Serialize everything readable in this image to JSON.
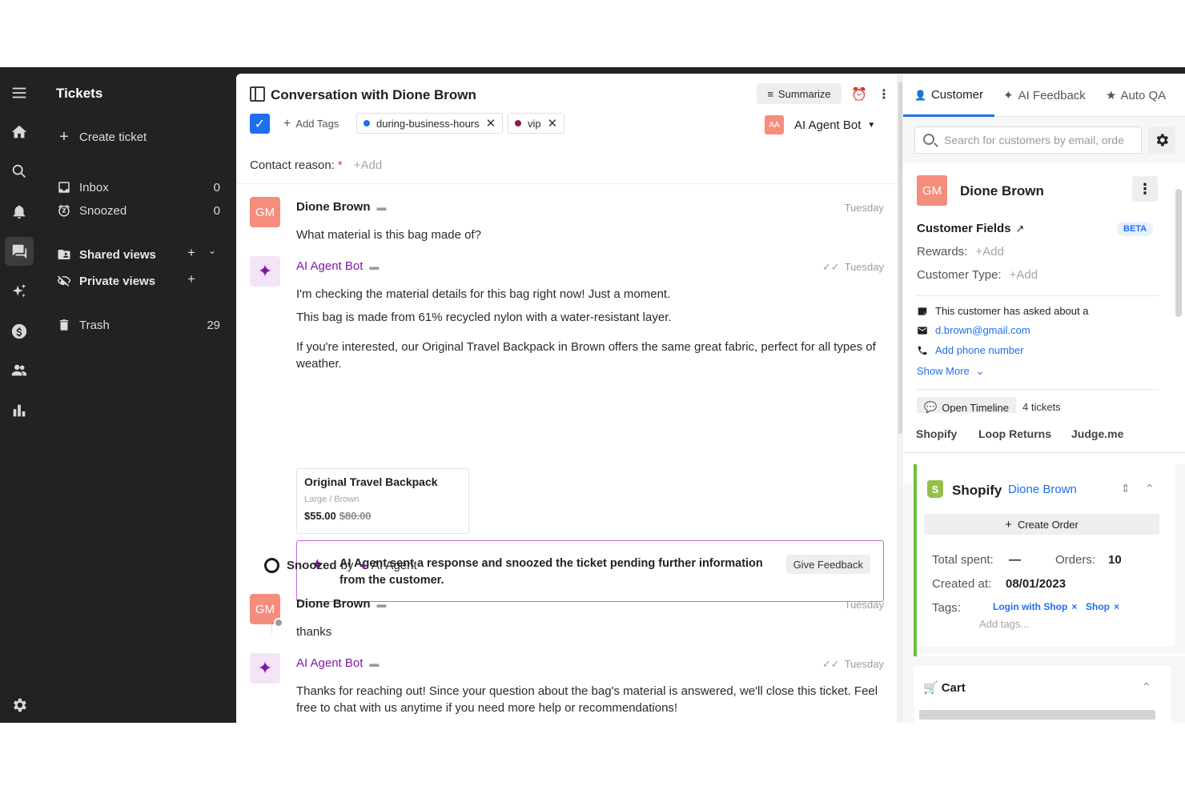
{
  "sidebar": {
    "title": "Tickets",
    "create_ticket": "Create ticket",
    "inbox_label": "Inbox",
    "inbox_count": "0",
    "snoozed_label": "Snoozed",
    "snoozed_count": "0",
    "shared_views": "Shared views",
    "private_views": "Private views",
    "trash_label": "Trash",
    "trash_count": "29"
  },
  "conversation": {
    "title": "Conversation with Dione Brown",
    "summarize": "Summarize",
    "add_tags": "Add Tags",
    "tags": [
      {
        "label": "during-business-hours",
        "color": "#1e6ff0"
      },
      {
        "label": "vip",
        "color": "#8a1d4a"
      }
    ],
    "assignee_initials": "AA",
    "assignee": "AI Agent Bot",
    "contact_reason_label": "Contact reason:",
    "contact_reason_required": "*",
    "contact_reason_add": "+Add"
  },
  "messages": {
    "m1": {
      "initials": "GM",
      "sender": "Dione Brown",
      "time": "Tuesday",
      "text": "What material is this bag made of?"
    },
    "m2": {
      "sender": "AI Agent Bot",
      "time": "Tuesday",
      "line1": "I'm checking the material details for this bag right now! Just a moment.",
      "line2": "This bag is made from 61% recycled nylon with a water-resistant layer.",
      "line3": "If you're interested, our Original Travel Backpack in Brown offers the same great fabric, perfect for all types of weather.",
      "product": {
        "name": "Original Travel Backpack",
        "variant": "Large / Brown",
        "price": "$55.00",
        "compare_price": "$80.00"
      },
      "note": "AI Agent sent a response and snoozed the ticket pending further information from the customer.",
      "feedback_button": "Give Feedback"
    },
    "snooze": {
      "prefix": "Snoozed",
      "by": "by",
      "agent": "AI Agent"
    },
    "m3": {
      "initials": "GM",
      "sender": "Dione Brown",
      "time": "Tuesday",
      "text": "thanks"
    },
    "m4": {
      "sender": "AI Agent Bot",
      "time": "Tuesday",
      "text": "Thanks for reaching out! Since your question about the bag's material is answered, we'll close this ticket. Feel free to chat with us anytime if you need more help or recommendations!"
    }
  },
  "right_panel": {
    "tabs": [
      "Customer",
      "AI Feedback",
      "Auto QA"
    ],
    "search_placeholder": "Search for customers by email, orde",
    "customer": {
      "initials": "GM",
      "name": "Dione Brown",
      "fields_title": "Customer Fields",
      "beta": "BETA",
      "rewards_label": "Rewards:",
      "rewards_add": "+Add",
      "type_label": "Customer Type:",
      "type_add": "+Add",
      "note": "This customer has asked about a",
      "email": "d.brown@gmail.com",
      "phone": "Add phone number",
      "show_more": "Show More",
      "open_timeline": "Open Timeline",
      "tickets": "4 tickets"
    },
    "integrations": [
      "Shopify",
      "Loop Returns",
      "Judge.me"
    ],
    "shopify": {
      "title": "Shopify",
      "customer": "Dione Brown",
      "create_order": "Create Order",
      "total_spent_label": "Total spent:",
      "total_spent_value": "—",
      "orders_label": "Orders:",
      "orders_value": "10",
      "created_label": "Created at:",
      "created_value": "08/01/2023",
      "tags_label": "Tags:",
      "tags": [
        "Login with Shop",
        "Shop"
      ],
      "add_tags": "Add tags..."
    },
    "cart_title": "Cart"
  },
  "colors": {
    "accent": "#1e6ff0",
    "ai_purple": "#7c1aa3",
    "avatar": "#f58d7c",
    "shopify": "#95bf47"
  }
}
